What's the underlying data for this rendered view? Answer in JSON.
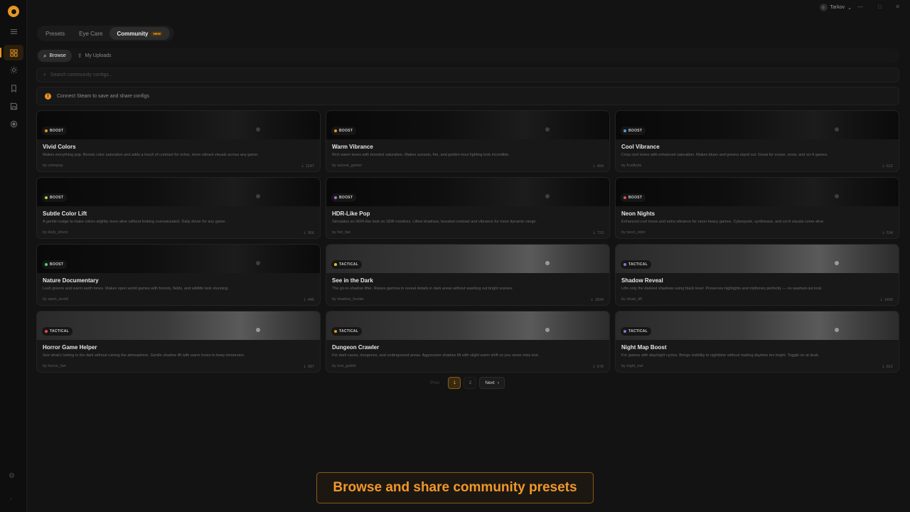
{
  "window": {
    "user_name": "Tarkov",
    "user_chevron": "⌄",
    "minimize": "—",
    "maximize": "□",
    "close": "✕"
  },
  "rail": {
    "items": [
      {
        "icon": "menu-icon"
      },
      {
        "icon": "grid-icon",
        "active": true
      },
      {
        "icon": "sun-icon"
      },
      {
        "icon": "bookmark-icon"
      },
      {
        "icon": "save-icon"
      },
      {
        "icon": "record-icon"
      }
    ],
    "settings_icon": "gear-icon"
  },
  "tabs": [
    {
      "label": "Presets"
    },
    {
      "label": "Eye Care"
    },
    {
      "label": "Community",
      "badge": "NEW",
      "active": true
    }
  ],
  "subnav": {
    "browse_label": "Browse",
    "uploads_label": "My Uploads"
  },
  "search": {
    "placeholder": "Search community configs..."
  },
  "notice": {
    "text": "Connect Steam to save and share configs",
    "icon_glyph": "!"
  },
  "cards": [
    {
      "category": "BOOST",
      "dot": "#e8951e",
      "thumb": "dark",
      "title": "Vivid Colors",
      "desc": "Makes everything pop. Boosts color saturation and adds a touch of contrast for richer, more vibrant visuals across any game.",
      "author": "by colorpop",
      "downloads": "1247"
    },
    {
      "category": "BOOST",
      "dot": "#e8951e",
      "thumb": "dark",
      "title": "Warm Vibrance",
      "desc": "Rich warm tones with boosted saturation. Makes sunsets, fire, and golden-hour lighting look incredible.",
      "author": "by sunset_gamer",
      "downloads": "654"
    },
    {
      "category": "BOOST",
      "dot": "#4a9ede",
      "thumb": "dark",
      "title": "Cool Vibrance",
      "desc": "Crisp cool tones with enhanced saturation. Makes blues and greens stand out. Great for ocean, snow, and sci-fi games.",
      "author": "by frostbyte",
      "downloads": "612"
    },
    {
      "category": "BOOST",
      "dot": "#a8d84a",
      "thumb": "dark",
      "title": "Subtle Color Lift",
      "desc": "A gentle nudge to make colors slightly more alive without looking oversaturated. Daily driver for any game.",
      "author": "by daily_driver",
      "downloads": "956"
    },
    {
      "category": "BOOST",
      "dot": "#b86ad8",
      "thumb": "dark",
      "title": "HDR-Like Pop",
      "desc": "Simulates an HDR-like look on SDR monitors. Lifted shadows, boosted contrast and vibrance for more dynamic range.",
      "author": "by hdr_fan",
      "downloads": "723"
    },
    {
      "category": "BOOST",
      "dot": "#e84a4a",
      "thumb": "dark",
      "title": "Neon Nights",
      "desc": "Enhanced cool tones and extra vibrance for neon-heavy games. Cyberpunk, synthwave, and sci-fi visuals come alive.",
      "author": "by neon_rider",
      "downloads": "534"
    },
    {
      "category": "BOOST",
      "dot": "#4ad86a",
      "thumb": "dark",
      "title": "Nature Documentary",
      "desc": "Lush greens and warm earth tones. Makes open world games with forests, fields, and wildlife look stunning.",
      "author": "by open_world",
      "downloads": "445"
    },
    {
      "category": "TACTICAL",
      "dot": "#e8c41e",
      "thumb": "light",
      "title": "See in the Dark",
      "desc": "The go-to shadow lifter. Raises gamma to reveal details in dark areas without washing out bright scenes.",
      "author": "by shadow_hunter",
      "downloads": "1834"
    },
    {
      "category": "TACTICAL",
      "dot": "#7a7ad8",
      "thumb": "light",
      "title": "Shadow Reveal",
      "desc": "Lifts only the darkest shadows using black level. Preserves highlights and midtones perfectly — no washed-out look.",
      "author": "by clean_lift",
      "downloads": "1456"
    },
    {
      "category": "TACTICAL",
      "dot": "#e84a4a",
      "thumb": "light",
      "title": "Horror Game Helper",
      "desc": "See what's lurking in the dark without ruining the atmosphere. Gentle shadow lift with warm tones to keep immersion.",
      "author": "by horror_fan",
      "downloads": "987"
    },
    {
      "category": "TACTICAL",
      "dot": "#e8951e",
      "thumb": "light",
      "title": "Dungeon Crawler",
      "desc": "For dark caves, dungeons, and underground areas. Aggressive shadow lift with slight warm shift so you never miss loot.",
      "author": "by loot_goblin",
      "downloads": "678"
    },
    {
      "category": "TACTICAL",
      "dot": "#7a7ad8",
      "thumb": "light",
      "title": "Night Map Boost",
      "desc": "For games with day/night cycles. Brings visibility to nighttime without making daytime too bright. Toggle on at dusk.",
      "author": "by night_owl",
      "downloads": "812"
    }
  ],
  "pagination": {
    "prev": "Prev",
    "pages": [
      "1",
      "2"
    ],
    "current": "1",
    "next": "Next",
    "next_icon": "›"
  },
  "banner": {
    "text": "Browse and share community presets"
  }
}
